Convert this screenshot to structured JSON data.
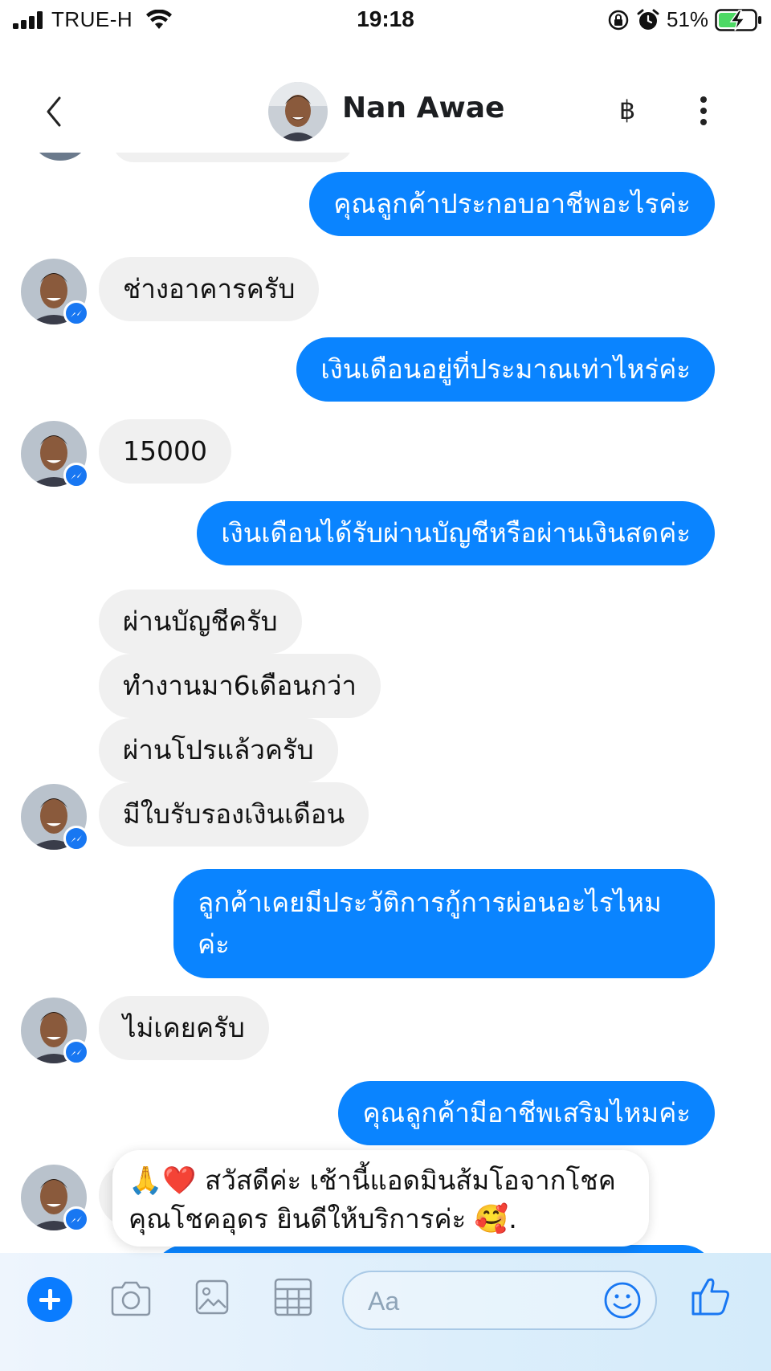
{
  "status_bar": {
    "carrier": "TRUE-H",
    "time": "19:18",
    "battery_percent": "51%"
  },
  "header": {
    "contact_name": "Nan Awae",
    "baht_label": "฿"
  },
  "messages": [
    {
      "side": "out",
      "text": "คุณลูกค้าประกอบอาชีพอะไรค่ะ"
    },
    {
      "side": "in",
      "text": "ช่างอาคารครับ"
    },
    {
      "side": "out",
      "text": "เงินเดือนอยู่ที่ประมาณเท่าไหร่ค่ะ"
    },
    {
      "side": "in",
      "text": "15000"
    },
    {
      "side": "out",
      "text": "เงินเดือนได้รับผ่านบัญชีหรือผ่านเงินสดค่ะ"
    },
    {
      "side": "in",
      "text": "ผ่านบัญชีครับ"
    },
    {
      "side": "in",
      "text": "ทำงานมา6เดือนกว่า"
    },
    {
      "side": "in",
      "text": "ผ่านโปรแล้วครับ"
    },
    {
      "side": "in",
      "text": "มีใบรับรองเงินเดือน"
    },
    {
      "side": "out",
      "text": "ลูกค้าเคยมีประวัติการกู้การผ่อนอะไรไหม ค่ะ"
    },
    {
      "side": "in",
      "text": "ไม่เคยครับ"
    },
    {
      "side": "out",
      "text": "คุณลูกค้ามีอาชีพเสริมไหมค่ะ"
    }
  ],
  "toast": {
    "emoji_prefix": "🙏❤️",
    "line1": "สวัสดีค่ะ เช้านี้แอดมินส้มโอจากโชค",
    "line2": "คุณโชคอุดร ยินดีให้บริการค่ะ",
    "emoji_suffix": "🥰."
  },
  "composer": {
    "placeholder": "Aa"
  }
}
